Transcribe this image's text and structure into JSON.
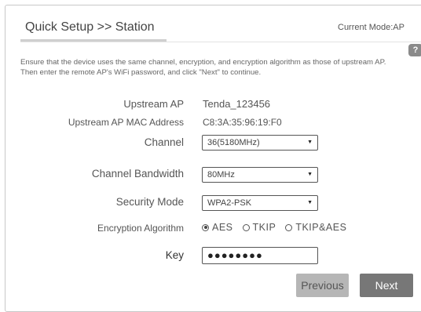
{
  "header": {
    "title": "Quick Setup >> Station",
    "mode": "Current Mode:AP",
    "help": "?"
  },
  "intro": {
    "line1": "Ensure that the device uses the same channel, encryption, and encryption algorithm as those of upstream AP.",
    "line2": "Then enter the remote AP's WiFi password, and click \"Next\" to continue."
  },
  "form": {
    "upstream_ap_label": "Upstream AP",
    "upstream_ap_value": "Tenda_123456",
    "mac_label": "Upstream AP MAC Address",
    "mac_value": "C8:3A:35:96:19:F0",
    "channel_label": "Channel",
    "channel_value": "36(5180MHz)",
    "bandwidth_label": "Channel Bandwidth",
    "bandwidth_value": "80MHz",
    "security_label": "Security Mode",
    "security_value": "WPA2-PSK",
    "encryption_label": "Encryption Algorithm",
    "encryption_options": [
      "AES",
      "TKIP",
      "TKIP&AES"
    ],
    "encryption_selected": "AES",
    "key_label": "Key",
    "key_value": "●●●●●●●●"
  },
  "buttons": {
    "previous": "Previous",
    "next": "Next"
  }
}
